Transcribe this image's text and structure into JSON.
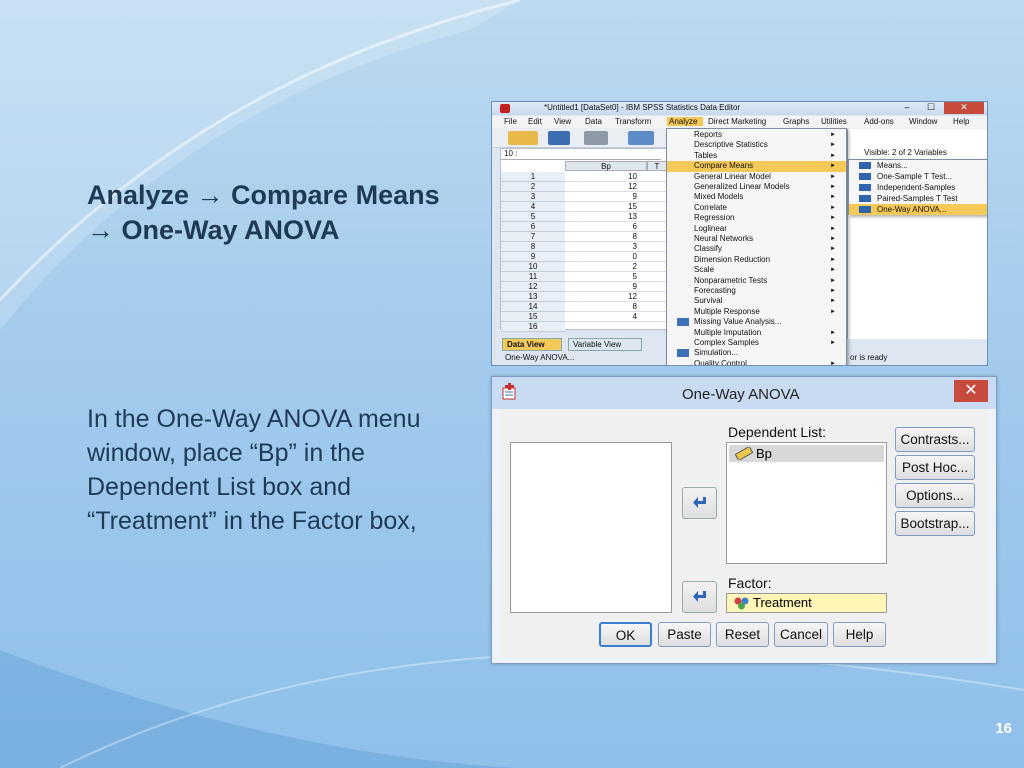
{
  "slide": {
    "heading_line1": "Analyze → Compare Means",
    "heading_line2": "→ One-Way ANOVA",
    "body": "In the One-Way ANOVA menu window, place “Bp” in the Dependent List box and “Treatment” in the Factor box,",
    "page_number": "16"
  },
  "spss": {
    "title": "*Untitled1 [DataSet0] - IBM SPSS Statistics Data Editor",
    "window_buttons": {
      "min": "–",
      "max": "☐",
      "close": "✕"
    },
    "menubar": [
      "File",
      "Edit",
      "View",
      "Data",
      "Transform",
      "Analyze",
      "Direct Marketing",
      "Graphs",
      "Utilities",
      "Add-ons",
      "Window",
      "Help"
    ],
    "active_menu": "Analyze",
    "cell_ref": "10 :",
    "visible": "Visible: 2 of 2 Variables",
    "columns": [
      "Bp",
      "T"
    ],
    "rows": [
      {
        "n": "1",
        "bp": "10"
      },
      {
        "n": "2",
        "bp": "12"
      },
      {
        "n": "3",
        "bp": "9"
      },
      {
        "n": "4",
        "bp": "15"
      },
      {
        "n": "5",
        "bp": "13"
      },
      {
        "n": "6",
        "bp": "6"
      },
      {
        "n": "7",
        "bp": "8"
      },
      {
        "n": "8",
        "bp": "3"
      },
      {
        "n": "9",
        "bp": "0"
      },
      {
        "n": "10",
        "bp": "2"
      },
      {
        "n": "11",
        "bp": "5"
      },
      {
        "n": "12",
        "bp": "9"
      },
      {
        "n": "13",
        "bp": "12"
      },
      {
        "n": "14",
        "bp": "8"
      },
      {
        "n": "15",
        "bp": "4"
      },
      {
        "n": "16",
        "bp": ""
      }
    ],
    "analyze_menu": [
      {
        "label": "Reports",
        "sub": true
      },
      {
        "label": "Descriptive Statistics",
        "sub": true
      },
      {
        "label": "Tables",
        "sub": true
      },
      {
        "label": "Compare Means",
        "sub": true,
        "highlight": true
      },
      {
        "label": "General Linear Model",
        "sub": true
      },
      {
        "label": "Generalized Linear Models",
        "sub": true
      },
      {
        "label": "Mixed Models",
        "sub": true
      },
      {
        "label": "Correlate",
        "sub": true
      },
      {
        "label": "Regression",
        "sub": true
      },
      {
        "label": "Loglinear",
        "sub": true
      },
      {
        "label": "Neural Networks",
        "sub": true
      },
      {
        "label": "Classify",
        "sub": true
      },
      {
        "label": "Dimension Reduction",
        "sub": true
      },
      {
        "label": "Scale",
        "sub": true
      },
      {
        "label": "Nonparametric Tests",
        "sub": true
      },
      {
        "label": "Forecasting",
        "sub": true
      },
      {
        "label": "Survival",
        "sub": true
      },
      {
        "label": "Multiple Response",
        "sub": true
      },
      {
        "label": "Missing Value Analysis...",
        "sub": false,
        "icon": true
      },
      {
        "label": "Multiple Imputation",
        "sub": true
      },
      {
        "label": "Complex Samples",
        "sub": true
      },
      {
        "label": "Simulation...",
        "sub": false,
        "icon": true
      },
      {
        "label": "Quality Control",
        "sub": true
      }
    ],
    "compare_means_menu": [
      {
        "label": "Means..."
      },
      {
        "label": "One-Sample T Test..."
      },
      {
        "label": "Independent-Samples"
      },
      {
        "label": "Paired-Samples T Test"
      },
      {
        "label": "One-Way ANOVA...",
        "highlight": true
      }
    ],
    "tabs": [
      "Data View",
      "Variable View"
    ],
    "status_left": "One-Way ANOVA...",
    "status_right": "or is ready"
  },
  "dialog": {
    "title": "One-Way ANOVA",
    "close": "✕",
    "dependent_label": "Dependent List:",
    "dependent_item": "Bp",
    "factor_label": "Factor:",
    "factor_item": "Treatment",
    "side_buttons": [
      "Contrasts...",
      "Post Hoc...",
      "Options...",
      "Bootstrap..."
    ],
    "bottom_buttons": [
      "OK",
      "Paste",
      "Reset",
      "Cancel",
      "Help"
    ]
  },
  "colors": {
    "highlight": "#f5c957",
    "close_red": "#c74b3d",
    "text_dark": "#1f3a56"
  }
}
